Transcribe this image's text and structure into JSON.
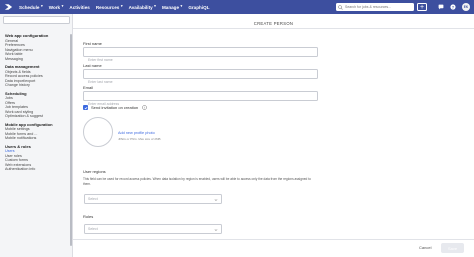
{
  "topbar": {
    "nav": [
      {
        "label": "Schedule",
        "dropdown": true
      },
      {
        "label": "Work",
        "dropdown": true
      },
      {
        "label": "Activities",
        "dropdown": false
      },
      {
        "label": "Resources",
        "dropdown": true
      },
      {
        "label": "Availability",
        "dropdown": true
      },
      {
        "label": "Manage",
        "dropdown": true
      },
      {
        "label": "GraphiQL",
        "dropdown": false
      }
    ],
    "search_placeholder": "Search for jobs & resources...",
    "avatar_initials": "EK",
    "colors": {
      "bar": "#3d4f9f",
      "accent": "#3d6ae0"
    }
  },
  "sidebar": {
    "groups": [
      {
        "header": "Web app configuration",
        "items": [
          "General",
          "Preferences",
          "Navigation menu",
          "Work table",
          "Messaging"
        ]
      },
      {
        "header": "Data management",
        "items": [
          "Objects & fields",
          "Record access policies",
          "Data import/export",
          "Change history"
        ]
      },
      {
        "header": "Scheduling",
        "items": [
          "Jobs",
          "Offers",
          "Job templates",
          "Work card styling",
          "Optimization & suggest"
        ]
      },
      {
        "header": "Mobile app configuration",
        "items": [
          "Mobile settings",
          "Mobile forms and ...",
          "Mobile notifications"
        ]
      },
      {
        "header": "Users & roles",
        "items": [
          "Users",
          "User roles",
          "Custom forms",
          "Web extensions",
          "Authentication info"
        ]
      }
    ],
    "active_item": "Users"
  },
  "form": {
    "title": "CREATE PERSON",
    "first_name": {
      "label": "First name",
      "placeholder": "Enter first name"
    },
    "last_name": {
      "label": "Last name",
      "placeholder": "Enter last name"
    },
    "email": {
      "label": "Email",
      "placeholder": "Enter email address"
    },
    "send_invitation": {
      "label": "Send invitation on creation",
      "checked": true
    },
    "photo": {
      "link": "Add new profile photo",
      "hint": "JPEG or PNG. Max size of 2MB"
    },
    "user_regions": {
      "label": "User regions",
      "description": "This field can be used for record access policies. When data isolation by region is enabled, users will be able to access only the data from the regions assigned to them.",
      "placeholder": "Select"
    },
    "roles": {
      "label": "Roles",
      "placeholder": "Select"
    }
  },
  "footer": {
    "cancel_label": "Cancel",
    "save_label": "Save"
  }
}
